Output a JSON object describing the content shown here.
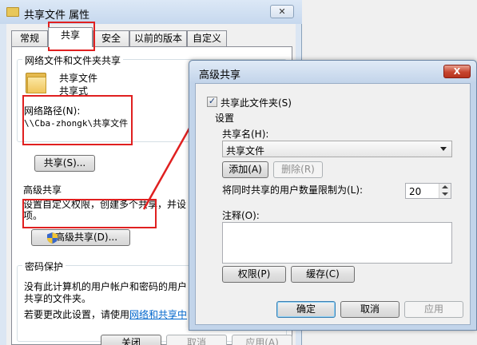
{
  "properties_window": {
    "title": "共享文件 属性",
    "close_glyph": "✕",
    "tabs": [
      {
        "label": "常规"
      },
      {
        "label": "共享"
      },
      {
        "label": "安全"
      },
      {
        "label": "以前的版本"
      },
      {
        "label": "自定义"
      }
    ],
    "network_sharing": {
      "group_title": "网络文件和文件夹共享",
      "item_name": "共享文件",
      "item_status": "共享式",
      "path_label": "网络路径(N):",
      "path_value": "\\\\Cba-zhongk\\共享文件",
      "share_button": "共享(S)..."
    },
    "advanced_sharing": {
      "group_title": "高级共享",
      "description": "设置自定义权限，创建多个共享，并设",
      "description_cont": "项。",
      "button": "高级共享(D)..."
    },
    "password": {
      "group_title": "密码保护",
      "line1": "没有此计算机的用户帐户和密码的用户",
      "line2": "共享的文件夹。",
      "line3_prefix": "若要更改此设置，请使用",
      "link": "网络和共享中"
    },
    "buttons": {
      "close": "关闭",
      "cancel": "取消",
      "apply": "应用(A)"
    }
  },
  "advanced_dialog": {
    "title": "高级共享",
    "close_glyph": "X",
    "share_checkbox_label": "共享此文件夹(S)",
    "share_checked": true,
    "check_glyph": "✓",
    "settings_label": "设置",
    "share_name_label": "共享名(H):",
    "share_name_value": "共享文件",
    "add_button": "添加(A)",
    "remove_button": "删除(R)",
    "user_limit_label": "将同时共享的用户数量限制为(L):",
    "user_limit_value": "20",
    "comments_label": "注释(O):",
    "permissions_button": "权限(P)",
    "caching_button": "缓存(C)",
    "ok_button": "确定",
    "cancel_button": "取消",
    "apply_button": "应用"
  },
  "colors": {
    "highlight_box": "#e02020",
    "link": "#0066cc"
  }
}
